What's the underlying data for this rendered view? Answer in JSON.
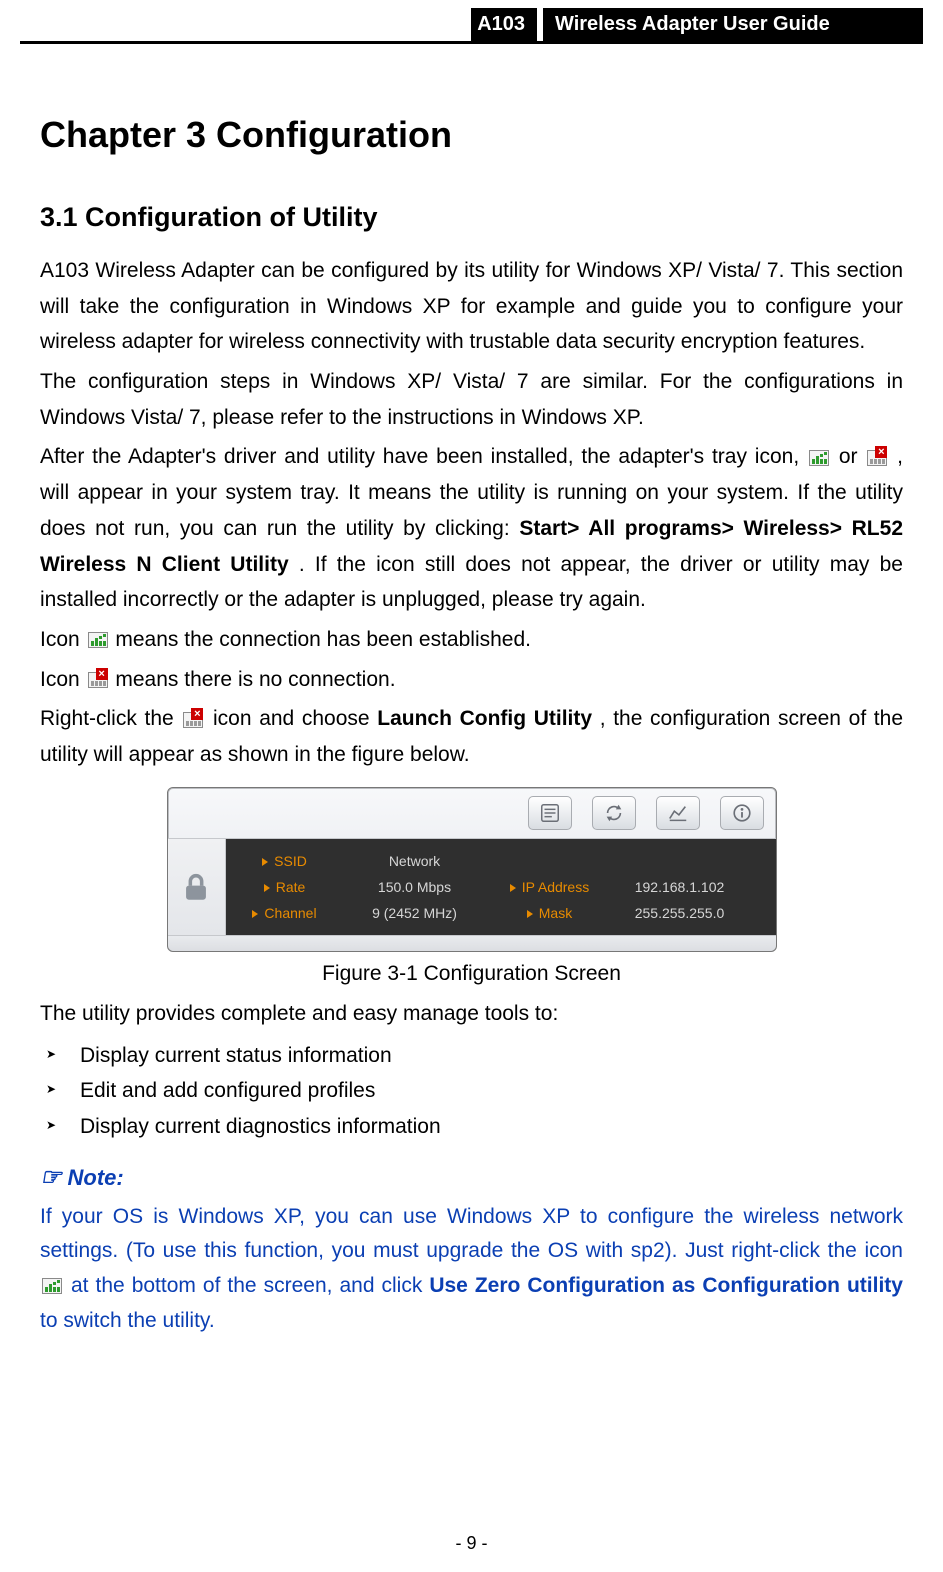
{
  "header": {
    "model": "A103",
    "title": "Wireless Adapter User Guide"
  },
  "chapter": "Chapter 3   Configuration",
  "section": "3.1   Configuration of Utility",
  "para1": "A103 Wireless Adapter can be configured by its utility for Windows XP/ Vista/ 7. This section will take the configuration in Windows XP for example and guide you to configure your wireless adapter for wireless connectivity with trustable data security encryption features.",
  "para2": "The configuration steps in Windows XP/ Vista/ 7 are similar. For the configurations in Windows Vista/ 7, please refer to the instructions in Windows XP.",
  "para3_a": "After the Adapter's driver and utility have been installed, the adapter's tray icon, ",
  "para3_b": " or ",
  "para3_c": ", will appear in your system tray. It means the utility is running on your system. If the utility does not run, you can run the utility by clicking: ",
  "para3_path": "Start> All programs> Wireless> RL52 Wireless N Client Utility",
  "para3_d": ". If the icon still does not appear, the driver or utility may be installed incorrectly or the adapter is unplugged, please try again.",
  "icon_line1_a": "Icon ",
  "icon_line1_b": "means the connection has been established.",
  "icon_line2_a": "Icon ",
  "icon_line2_b": "means there is no connection.",
  "para4_a": "Right-click the ",
  "para4_b": " icon and choose ",
  "para4_bold": "Launch Config Utility",
  "para4_c": ", the configuration screen of the utility will appear as shown in the figure below.",
  "screenshot": {
    "labels": {
      "ssid": "SSID",
      "rate": "Rate",
      "channel": "Channel",
      "ip": "IP Address",
      "mask": "Mask"
    },
    "values": {
      "ssid": "Network",
      "rate": "150.0 Mbps",
      "channel": "9 (2452 MHz)",
      "ip": "192.168.1.102",
      "mask": "255.255.255.0"
    }
  },
  "caption": "Figure 3-1 Configuration Screen",
  "manage_lead": "The utility provides complete and easy manage tools to:",
  "bullets": [
    "Display current status information",
    "Edit and add configured profiles",
    "Display current diagnostics information"
  ],
  "note_label": "Note:",
  "note_a": "If your OS is Windows XP, you can use Windows XP to configure the wireless network settings. (To use this function, you must upgrade the OS with sp2). Just right-click the icon ",
  "note_b": " at the bottom of the screen, and click ",
  "note_bold": "Use Zero Configuration as Configuration utility",
  "note_c": " to switch the utility.",
  "page_number": "- 9 -"
}
